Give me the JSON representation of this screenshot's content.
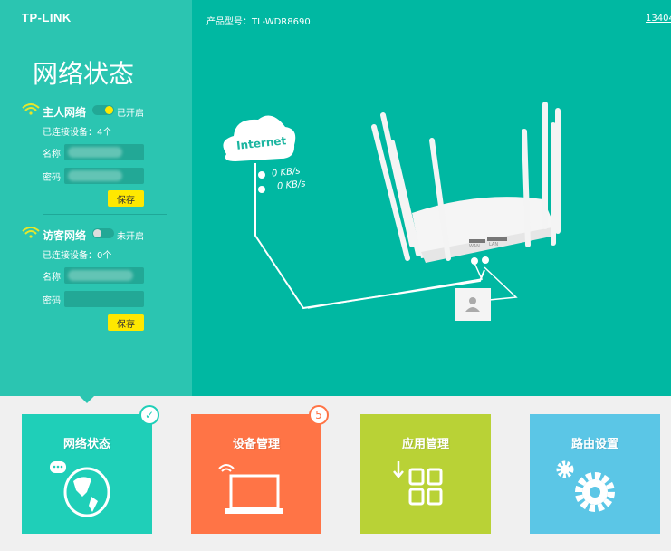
{
  "brand": "TP-LINK",
  "header": {
    "model_label": "产品型号：TL-WDR8690",
    "account_link": "13404"
  },
  "sidebar": {
    "title": "网络状态",
    "host_network": {
      "name": "主人网络",
      "state": "已开启",
      "enabled": true,
      "connected": "已连接设备：4个",
      "name_label": "名称",
      "password_label": "密码",
      "save": "保存"
    },
    "guest_network": {
      "name": "访客网络",
      "state": "未开启",
      "enabled": false,
      "connected": "已连接设备：0个",
      "name_label": "名称",
      "password_label": "密码",
      "save": "保存"
    }
  },
  "diagram": {
    "cloud_label": "Internet",
    "upload": "0 KB/s",
    "download": "0 KB/s",
    "router_ports": [
      "WAN",
      "LAN"
    ]
  },
  "tiles": [
    {
      "label": "网络状态",
      "color": "#1fcfb8",
      "icon": "globe-chat-icon",
      "badge": "check"
    },
    {
      "label": "设备管理",
      "color": "#ff7446",
      "icon": "laptop-wifi-icon",
      "badge": "5"
    },
    {
      "label": "应用管理",
      "color": "#b9d236",
      "icon": "apps-grid-icon"
    },
    {
      "label": "路由设置",
      "color": "#5bc6e6",
      "icon": "gears-icon"
    }
  ]
}
